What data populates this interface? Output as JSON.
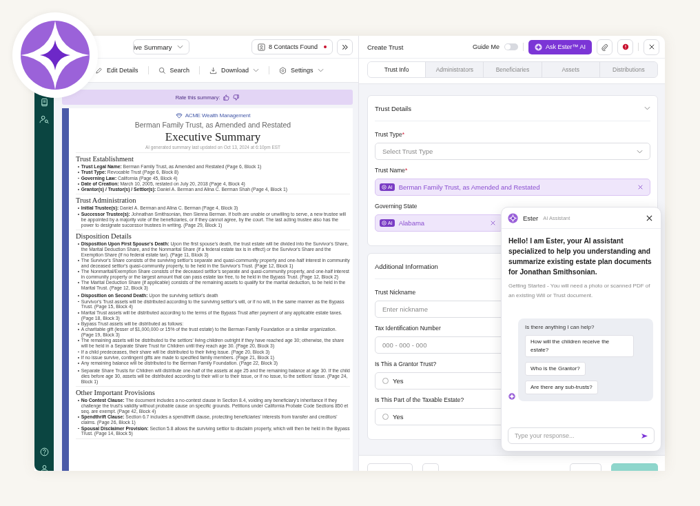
{
  "left_panel": {
    "view_dropdown": {
      "label": "ive Summary"
    },
    "contacts_button": {
      "label": "8 Contacts Found",
      "alert": true
    },
    "toolbar": [
      {
        "label": "Edit Details",
        "kind": "edit",
        "menu": false
      },
      {
        "label": "Search",
        "kind": "search",
        "menu": false
      },
      {
        "label": "Download",
        "kind": "download",
        "menu": true
      },
      {
        "label": "Settings",
        "kind": "settings",
        "menu": true
      }
    ],
    "rating_bar": {
      "label": "Rate this summary:"
    },
    "document": {
      "org": "ACME Wealth Management",
      "subtitle": "Berman Family Trust, as Amended and Restated",
      "title": "Executive Summary",
      "updated": "AI generated summary last updated on Oct 13, 2024 at 6:10pm EST",
      "sections": [
        {
          "heading": "Trust Establishment",
          "groups": [
            [
              "**Trust Legal Name:** Berman Family Trust, as Amended and Restated (Page 6, Block 1)",
              "**Trust Type:** Revocable Trust (Page 6, Block 8)",
              "**Governing Law:** California (Page 45, Block 4)",
              "**Date of Creation:** March 10, 2005, restated on July 20, 2018 (Page 4, Block 4)",
              "**Grantor(s) / Trustor(s) / Settlor(s):** Daniel A. Berman and Alina C. Berman Shah (Page 4, Block 1)"
            ]
          ]
        },
        {
          "heading": "Trust Administration",
          "groups": [
            [
              "**Initial Trustee(s):** Daniel A. Berman and Alina C. Berman (Page 4, Block 3)",
              "**Successor Trustee(s):** Johnathan Smithsonian, then Sienna Berman. If both are unable or unwilling to serve, a new trustee will be appointed by a majority vote of the beneficiaries, or if they cannot agree, by the court. The last acting trustee also has the power to designate successor trustees in writing. (Page 29, Block 1)"
            ]
          ]
        },
        {
          "heading": "Disposition Details",
          "groups": [
            [
              "**Disposition Upon First Spouse's Death:** Upon the first spouse's death, the trust estate will be divided into the Survivor's Share, the Marital Deduction Share, and the Nonmarital Share (if a federal estate tax is in effect) or the Survivor's Share and the Exemption Share (if no federal estate tax). (Page 11, Block 3)",
              "The Survivor's Share consists of the surviving settlor's separate and quasi-community property and one-half interest in community and deceased settlor's quasi-community property, to be held in the Survivor's Trust. (Page 12, Block 1)",
              "The Nonmarital/Exemption Share consists of the deceased settlor's separate and quasi-community property, and one-half interest in community property or the largest amount that can pass estate tax free, to be held in the Bypass Trust. (Page 12, Block 2)",
              "The Marital Deduction Share (if applicable) consists of the remaining assets to qualify for the marital deduction, to be held in the Marital Trust. (Page 12, Block 3)"
            ],
            [
              "**Disposition on Second Death:** Upon the surviving settlor's death",
              "Survivor's Trust assets will be distributed according to the surviving settlor's will, or if no will, in the same manner as the Bypass Trust. (Page 15, Block 4)",
              "Marital Trust assets will be distributed according to the terms of the Bypass Trust after payment of any applicable estate taxes. (Page 18, Block 3)",
              "Bypass Trust assets will be distributed as follows:",
              "A charitable gift (lesser of $1,000,000 or 15% of the trust estate) to the Berman Family Foundation or a similar organization. (Page 19, Block 3)",
              "The remaining assets will be distributed to the settlors' living children outright if they have reached age 30; otherwise, the share will be held in a Separate Share Trust for Children until they reach age 30. (Page 20, Block 3)",
              "If a child predeceases, their share will be distributed to their living issue. (Page 20, Block 3)",
              "If no issue survive, contingent gifts are made to specified family members. (Page 21, Block 1)",
              "Any remaining balance will be distributed to the Berman Family Foundation. (Page 22, Block 3)"
            ],
            [
              "Separate Share Trusts for Children will distribute one-half of the assets at age 25 and the remaining balance at age 30. If the child dies before age 30, assets will be distributed according to their will or to their issue, or if no issue, to the settlors' issue. (Page 24, Block 1)"
            ]
          ]
        },
        {
          "heading": "Other Important Provisions",
          "groups": [
            [
              "**No Contest Clause:** The document includes a no-contest clause in Section 8.4, voiding any beneficiary's inheritance if they challenge the trust's validity without probable cause on specific grounds. Petitions under California Probate Code Sections 850 et seq. are exempt. (Page 42, Block 4)",
              "**Spendthrift Clause:** Section 6.7 includes a spendthrift clause, protecting beneficiaries' interests from transfer and creditors' claims. (Page 26, Block 1)",
              "**Spousal Disclaimer Provision:** Section 5.8 allows the surviving settlor to disclaim property, which will then be held in the Bypass Trust. (Page 14, Block 5)"
            ]
          ]
        }
      ]
    }
  },
  "create_panel": {
    "title": "Create Trust",
    "guide_me": {
      "label": "Guide Me",
      "on": false
    },
    "ask_button": {
      "label": "Ask Ester™ AI"
    },
    "alert": true,
    "tabs": [
      {
        "label": "Trust Info",
        "selected": true
      },
      {
        "label": "Administrators",
        "selected": false
      },
      {
        "label": "Beneficiaries",
        "selected": false
      },
      {
        "label": "Assets",
        "selected": false
      },
      {
        "label": "Distributions",
        "selected": false
      }
    ],
    "sections": [
      {
        "title": "Trust Details",
        "collapsible": true,
        "fields": [
          {
            "kind": "select",
            "label": "Trust Type",
            "required_mark": "*",
            "placeholder": "Select Trust Type"
          },
          {
            "kind": "ai",
            "label": "Trust Name",
            "required_mark": "*",
            "badge": "AI",
            "value": "Berman Family Trust, as Amended and Restated"
          },
          {
            "kind": "ai",
            "label": "Governing State",
            "badge": "AI",
            "value": "Alabama"
          }
        ]
      },
      {
        "title": "Additional Information",
        "fields": [
          {
            "kind": "text",
            "label": "Trust Nickname",
            "placeholder": "Enter nickname"
          },
          {
            "kind": "text",
            "label": "Tax Identification Number",
            "placeholder": "000 - 000 - 000"
          },
          {
            "kind": "radio",
            "label": "Is This a Grantor Trust?",
            "option": "Yes",
            "checked": false
          },
          {
            "kind": "radio",
            "label": "Is This Part of the Taxable Estate?",
            "option": "Yes",
            "checked": false
          }
        ]
      }
    ]
  },
  "chat": {
    "name": "Ester",
    "role": "AI Assistant",
    "greeting": "Hello! I am Ester, your AI assistant specialized to help you understanding and summarize existing estate plan documents for Jonathan Smithsonian.",
    "hint": "Getting Started - You will need a photo or scanned PDF of an existing Will or Trust document.",
    "prompt": "Is there anything I can help?",
    "suggestions": [
      "How will the children receive the estate?",
      "Who is the Grantor?",
      "Are there any sub-trusts?"
    ],
    "input": {
      "placeholder": "Type your response..."
    }
  }
}
